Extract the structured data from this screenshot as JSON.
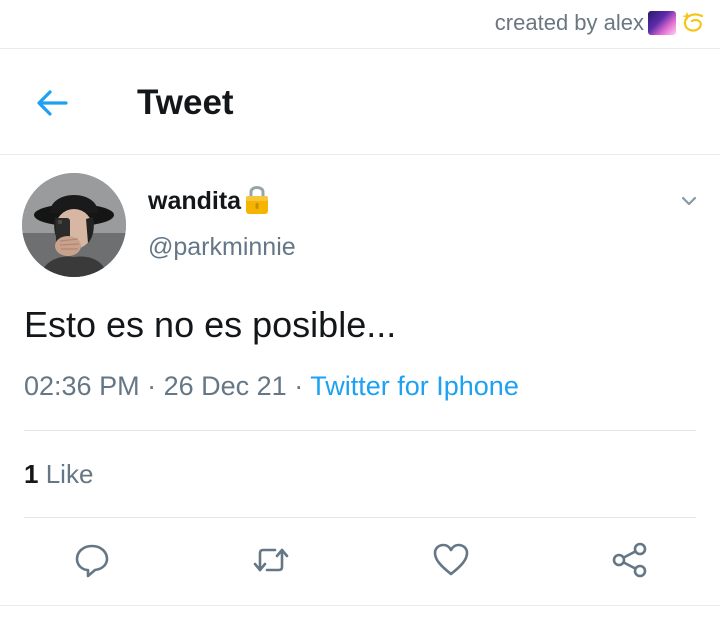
{
  "credit": {
    "text": "created by alex",
    "icons": [
      "milky-way-icon",
      "dizzy-star-icon"
    ]
  },
  "header": {
    "back_icon": "arrow-left-icon",
    "title": "Tweet"
  },
  "tweet": {
    "display_name": "wandita",
    "lock_icon": "lock-icon",
    "handle": "@parkminnie",
    "text": "Esto es no es posible...",
    "time": "02:36 PM",
    "separator": "·",
    "date": "26 Dec 21",
    "source": "Twitter for Iphone",
    "like_count": "1",
    "like_label": "Like"
  },
  "actions": [
    "reply-icon",
    "retweet-icon",
    "like-icon",
    "share-icon"
  ],
  "colors": {
    "accent": "#1da1f2",
    "text_primary": "#14171a",
    "text_secondary": "#657786",
    "divider": "#e6ecf0",
    "lock_gold": "#f4b400"
  }
}
